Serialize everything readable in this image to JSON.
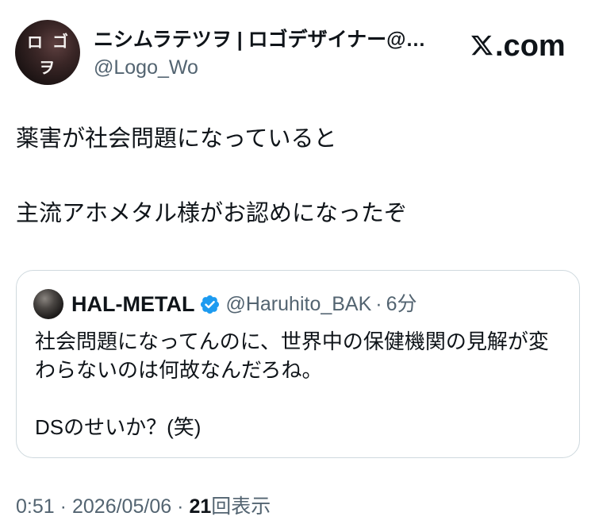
{
  "tweet": {
    "author": {
      "avatar_logo_text": [
        "ロ",
        "ゴ",
        "ヲ"
      ],
      "display_name": "ニシムラテツヲ | ロゴデザイナー@…",
      "handle": "@Logo_Wo"
    },
    "brand": {
      "icon": "x-logo-icon",
      "suffix": ".com"
    },
    "text_lines": [
      "薬害が社会問題になっていると",
      "主流アホメタル様がお認めになったぞ"
    ],
    "quote": {
      "author": {
        "display_name": "HAL-METAL",
        "verified": true,
        "verified_icon": "verified-badge-icon",
        "handle": "@Haruhito_BAK",
        "separator": "·",
        "time_ago": "6分"
      },
      "text_lines": [
        "社会問題になってんのに、世界中の保健機関の見解が変",
        "わらないのは何故なんだろね。",
        "DSのせいか？(笑)"
      ]
    },
    "footer": {
      "time": "0:51",
      "separator": "·",
      "date": "2026/05/06",
      "views_count": "21",
      "views_label": "回表示"
    }
  },
  "colors": {
    "text_primary": "#0f1419",
    "text_secondary": "#536471",
    "border": "#cfd9de",
    "verified_blue": "#1d9bf0",
    "background": "#ffffff"
  }
}
